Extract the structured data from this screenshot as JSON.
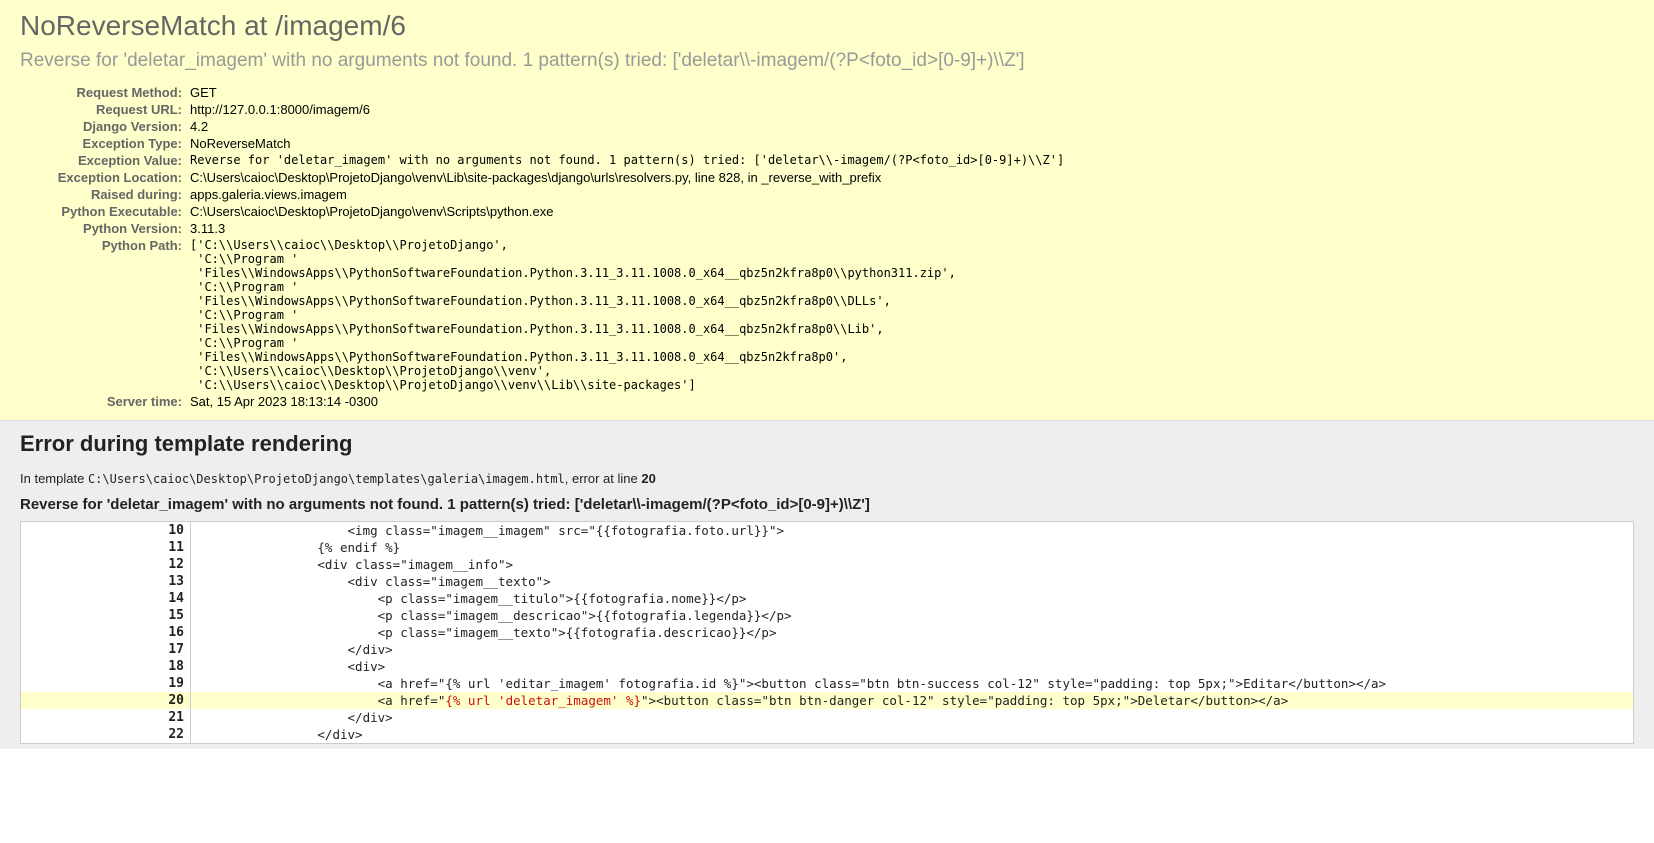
{
  "summary": {
    "title": "NoReverseMatch at /imagem/6",
    "subtitle": "Reverse for 'deletar_imagem' with no arguments not found. 1 pattern(s) tried: ['deletar\\\\-imagem/(?P<foto_id>[0-9]+)\\\\Z']"
  },
  "meta": {
    "request_method": {
      "label": "Request Method:",
      "value": "GET"
    },
    "request_url": {
      "label": "Request URL:",
      "value": "http://127.0.0.1:8000/imagem/6"
    },
    "django_version": {
      "label": "Django Version:",
      "value": "4.2"
    },
    "exception_type": {
      "label": "Exception Type:",
      "value": "NoReverseMatch"
    },
    "exception_value": {
      "label": "Exception Value:",
      "value": "Reverse for 'deletar_imagem' with no arguments not found. 1 pattern(s) tried: ['deletar\\\\-imagem/(?P<foto_id>[0-9]+)\\\\Z']"
    },
    "exception_location": {
      "label": "Exception Location:",
      "value": "C:\\Users\\caioc\\Desktop\\ProjetoDjango\\venv\\Lib\\site-packages\\django\\urls\\resolvers.py, line 828, in _reverse_with_prefix"
    },
    "raised_during": {
      "label": "Raised during:",
      "value": "apps.galeria.views.imagem"
    },
    "python_executable": {
      "label": "Python Executable:",
      "value": "C:\\Users\\caioc\\Desktop\\ProjetoDjango\\venv\\Scripts\\python.exe"
    },
    "python_version": {
      "label": "Python Version:",
      "value": "3.11.3"
    },
    "python_path": {
      "label": "Python Path:",
      "value": "['C:\\\\Users\\\\caioc\\\\Desktop\\\\ProjetoDjango',\n 'C:\\\\Program '\n 'Files\\\\WindowsApps\\\\PythonSoftwareFoundation.Python.3.11_3.11.1008.0_x64__qbz5n2kfra8p0\\\\python311.zip',\n 'C:\\\\Program '\n 'Files\\\\WindowsApps\\\\PythonSoftwareFoundation.Python.3.11_3.11.1008.0_x64__qbz5n2kfra8p0\\\\DLLs',\n 'C:\\\\Program '\n 'Files\\\\WindowsApps\\\\PythonSoftwareFoundation.Python.3.11_3.11.1008.0_x64__qbz5n2kfra8p0\\\\Lib',\n 'C:\\\\Program '\n 'Files\\\\WindowsApps\\\\PythonSoftwareFoundation.Python.3.11_3.11.1008.0_x64__qbz5n2kfra8p0',\n 'C:\\\\Users\\\\caioc\\\\Desktop\\\\ProjetoDjango\\\\venv',\n 'C:\\\\Users\\\\caioc\\\\Desktop\\\\ProjetoDjango\\\\venv\\\\Lib\\\\site-packages']"
    },
    "server_time": {
      "label": "Server time:",
      "value": "Sat, 15 Apr 2023 18:13:14 -0300"
    }
  },
  "template": {
    "heading": "Error during template rendering",
    "intro_prefix": "In template ",
    "intro_path": "C:\\Users\\caioc\\Desktop\\ProjetoDjango\\templates\\galeria\\imagem.html",
    "intro_mid": ", error at line ",
    "intro_line": "20",
    "error_message": "Reverse for 'deletar_imagem' with no arguments not found. 1 pattern(s) tried: ['deletar\\\\-imagem/(?P<foto_id>[0-9]+)\\\\Z']"
  },
  "source": {
    "rows": [
      {
        "n": "10",
        "code": "                    <img class=\"imagem__imagem\" src=\"{{fotografia.foto.url}}\">",
        "hl": false,
        "err": ""
      },
      {
        "n": "11",
        "code": "                {% endif %}",
        "hl": false,
        "err": ""
      },
      {
        "n": "12",
        "code": "                <div class=\"imagem__info\">",
        "hl": false,
        "err": ""
      },
      {
        "n": "13",
        "code": "                    <div class=\"imagem__texto\">",
        "hl": false,
        "err": ""
      },
      {
        "n": "14",
        "code": "                        <p class=\"imagem__titulo\">{{fotografia.nome}}</p>",
        "hl": false,
        "err": ""
      },
      {
        "n": "15",
        "code": "                        <p class=\"imagem__descricao\">{{fotografia.legenda}}</p>",
        "hl": false,
        "err": ""
      },
      {
        "n": "16",
        "code": "                        <p class=\"imagem__texto\">{{fotografia.descricao}}</p>",
        "hl": false,
        "err": ""
      },
      {
        "n": "17",
        "code": "                    </div>",
        "hl": false,
        "err": ""
      },
      {
        "n": "18",
        "code": "                    <div>",
        "hl": false,
        "err": ""
      },
      {
        "n": "19",
        "code": "                        <a href=\"{% url 'editar_imagem' fotografia.id %}\"><button class=\"btn btn-success col-12\" style=\"padding: top 5px;\">Editar</button></a>",
        "hl": false,
        "err": ""
      },
      {
        "n": "20",
        "code": "                        <a href=\"",
        "hl": true,
        "err": "{% url 'deletar_imagem' %}",
        "tail": "\"><button class=\"btn btn-danger col-12\" style=\"padding: top 5px;\">Deletar</button></a>"
      },
      {
        "n": "21",
        "code": "                    </div>",
        "hl": false,
        "err": ""
      },
      {
        "n": "22",
        "code": "                </div>",
        "hl": false,
        "err": ""
      }
    ]
  }
}
